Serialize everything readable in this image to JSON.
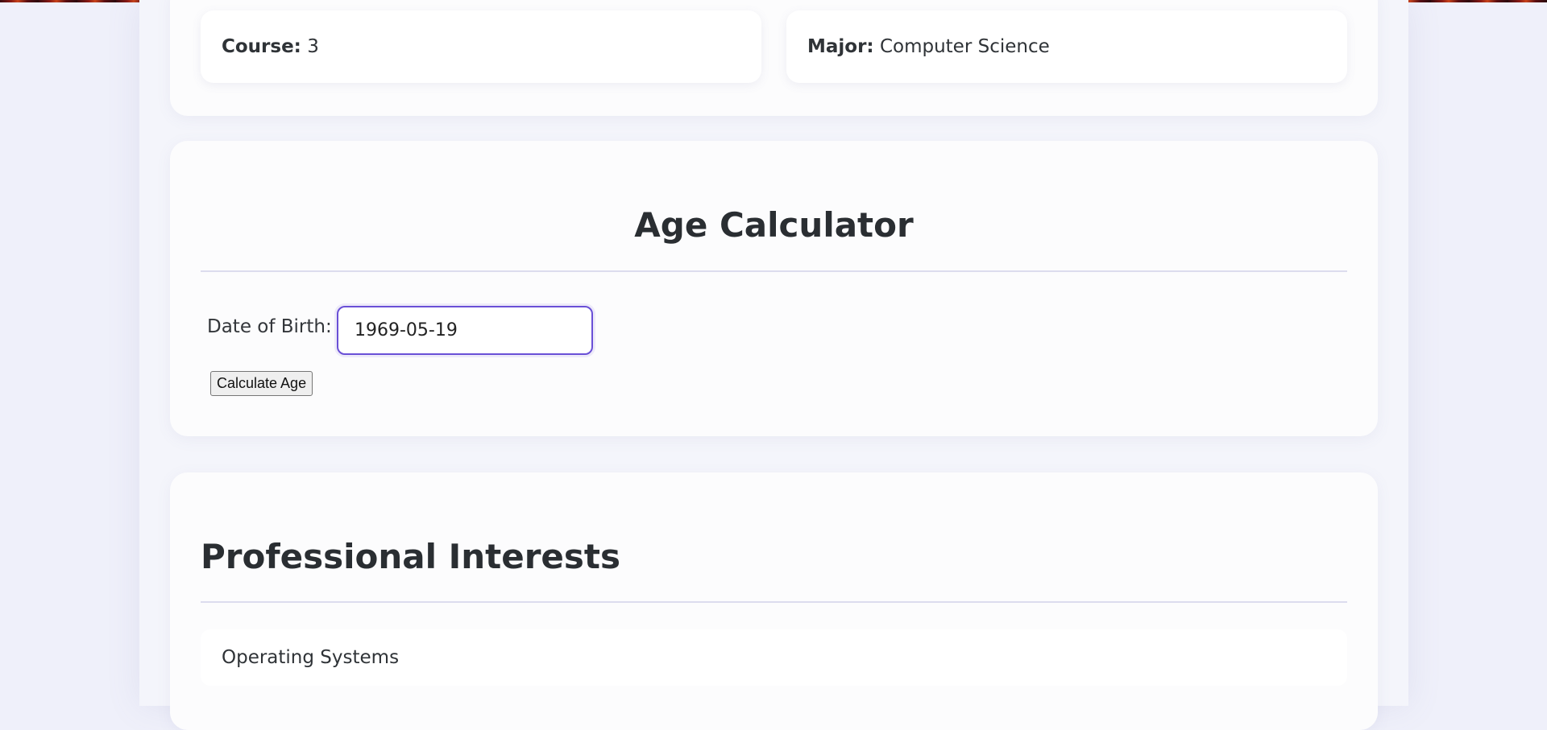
{
  "info": {
    "course_label": "Course:",
    "course_value": "3",
    "major_label": "Major:",
    "major_value": "Computer Science"
  },
  "age_calculator": {
    "title": "Age Calculator",
    "dob_label": "Date of Birth:",
    "dob_value": "1969-05-19",
    "calculate_label": "Calculate Age"
  },
  "interests": {
    "title": "Professional Interests",
    "items": [
      "Operating Systems"
    ]
  },
  "colors": {
    "accent": "#6a50d6",
    "background": "#eff0fa",
    "panel": "#fcfcfd",
    "text": "#2c2f33"
  }
}
